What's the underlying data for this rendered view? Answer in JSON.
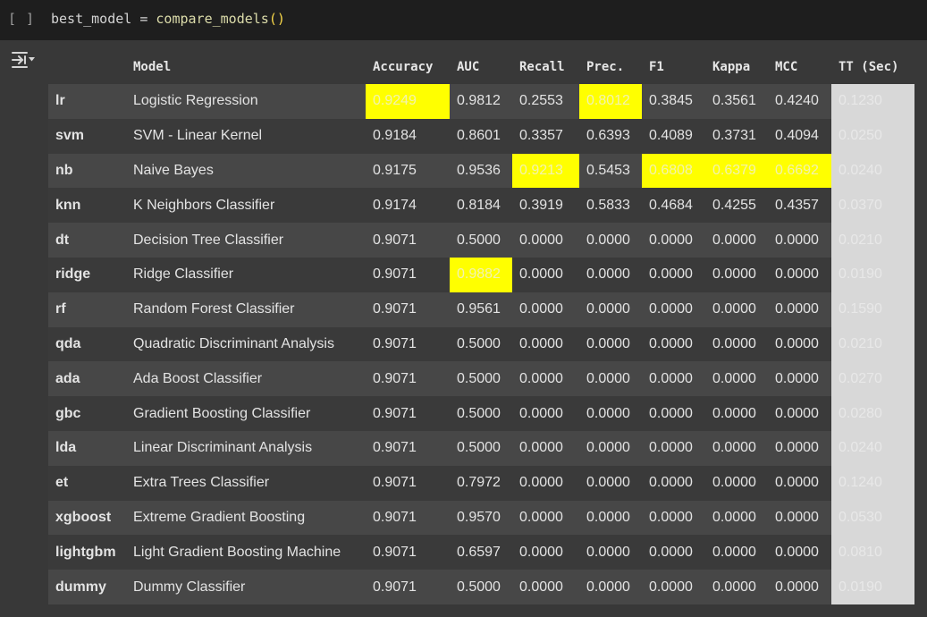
{
  "cell": {
    "run_indicator": "[ ]",
    "code_var": "best_model",
    "code_op": " = ",
    "code_fn": "compare_models",
    "code_parens": "()"
  },
  "table": {
    "headers": [
      "",
      "Model",
      "Accuracy",
      "AUC",
      "Recall",
      "Prec.",
      "F1",
      "Kappa",
      "MCC",
      "TT (Sec)"
    ],
    "rows": [
      {
        "id": "lr",
        "model": "Logistic Regression",
        "accuracy": "0.9249",
        "auc": "0.9812",
        "recall": "0.2553",
        "prec": "0.8012",
        "f1": "0.3845",
        "kappa": "0.3561",
        "mcc": "0.4240",
        "tt": "0.1230"
      },
      {
        "id": "svm",
        "model": "SVM - Linear Kernel",
        "accuracy": "0.9184",
        "auc": "0.8601",
        "recall": "0.3357",
        "prec": "0.6393",
        "f1": "0.4089",
        "kappa": "0.3731",
        "mcc": "0.4094",
        "tt": "0.0250"
      },
      {
        "id": "nb",
        "model": "Naive Bayes",
        "accuracy": "0.9175",
        "auc": "0.9536",
        "recall": "0.9213",
        "prec": "0.5453",
        "f1": "0.6808",
        "kappa": "0.6379",
        "mcc": "0.6692",
        "tt": "0.0240"
      },
      {
        "id": "knn",
        "model": "K Neighbors Classifier",
        "accuracy": "0.9174",
        "auc": "0.8184",
        "recall": "0.3919",
        "prec": "0.5833",
        "f1": "0.4684",
        "kappa": "0.4255",
        "mcc": "0.4357",
        "tt": "0.0370"
      },
      {
        "id": "dt",
        "model": "Decision Tree Classifier",
        "accuracy": "0.9071",
        "auc": "0.5000",
        "recall": "0.0000",
        "prec": "0.0000",
        "f1": "0.0000",
        "kappa": "0.0000",
        "mcc": "0.0000",
        "tt": "0.0210"
      },
      {
        "id": "ridge",
        "model": "Ridge Classifier",
        "accuracy": "0.9071",
        "auc": "0.9882",
        "recall": "0.0000",
        "prec": "0.0000",
        "f1": "0.0000",
        "kappa": "0.0000",
        "mcc": "0.0000",
        "tt": "0.0190"
      },
      {
        "id": "rf",
        "model": "Random Forest Classifier",
        "accuracy": "0.9071",
        "auc": "0.9561",
        "recall": "0.0000",
        "prec": "0.0000",
        "f1": "0.0000",
        "kappa": "0.0000",
        "mcc": "0.0000",
        "tt": "0.1590"
      },
      {
        "id": "qda",
        "model": "Quadratic Discriminant Analysis",
        "accuracy": "0.9071",
        "auc": "0.5000",
        "recall": "0.0000",
        "prec": "0.0000",
        "f1": "0.0000",
        "kappa": "0.0000",
        "mcc": "0.0000",
        "tt": "0.0210"
      },
      {
        "id": "ada",
        "model": "Ada Boost Classifier",
        "accuracy": "0.9071",
        "auc": "0.5000",
        "recall": "0.0000",
        "prec": "0.0000",
        "f1": "0.0000",
        "kappa": "0.0000",
        "mcc": "0.0000",
        "tt": "0.0270"
      },
      {
        "id": "gbc",
        "model": "Gradient Boosting Classifier",
        "accuracy": "0.9071",
        "auc": "0.5000",
        "recall": "0.0000",
        "prec": "0.0000",
        "f1": "0.0000",
        "kappa": "0.0000",
        "mcc": "0.0000",
        "tt": "0.0280"
      },
      {
        "id": "lda",
        "model": "Linear Discriminant Analysis",
        "accuracy": "0.9071",
        "auc": "0.5000",
        "recall": "0.0000",
        "prec": "0.0000",
        "f1": "0.0000",
        "kappa": "0.0000",
        "mcc": "0.0000",
        "tt": "0.0240"
      },
      {
        "id": "et",
        "model": "Extra Trees Classifier",
        "accuracy": "0.9071",
        "auc": "0.7972",
        "recall": "0.0000",
        "prec": "0.0000",
        "f1": "0.0000",
        "kappa": "0.0000",
        "mcc": "0.0000",
        "tt": "0.1240"
      },
      {
        "id": "xgboost",
        "model": "Extreme Gradient Boosting",
        "accuracy": "0.9071",
        "auc": "0.9570",
        "recall": "0.0000",
        "prec": "0.0000",
        "f1": "0.0000",
        "kappa": "0.0000",
        "mcc": "0.0000",
        "tt": "0.0530"
      },
      {
        "id": "lightgbm",
        "model": "Light Gradient Boosting Machine",
        "accuracy": "0.9071",
        "auc": "0.6597",
        "recall": "0.0000",
        "prec": "0.0000",
        "f1": "0.0000",
        "kappa": "0.0000",
        "mcc": "0.0000",
        "tt": "0.0810"
      },
      {
        "id": "dummy",
        "model": "Dummy Classifier",
        "accuracy": "0.9071",
        "auc": "0.5000",
        "recall": "0.0000",
        "prec": "0.0000",
        "f1": "0.0000",
        "kappa": "0.0000",
        "mcc": "0.0000",
        "tt": "0.0190"
      }
    ],
    "highlights": [
      {
        "row": 0,
        "col": "accuracy"
      },
      {
        "row": 0,
        "col": "prec"
      },
      {
        "row": 2,
        "col": "recall"
      },
      {
        "row": 2,
        "col": "f1"
      },
      {
        "row": 2,
        "col": "kappa"
      },
      {
        "row": 2,
        "col": "mcc"
      },
      {
        "row": 5,
        "col": "auc"
      }
    ]
  },
  "colors": {
    "highlight": "#ffff00",
    "tt_column": "#d8d8d8",
    "row_odd": "#474747",
    "row_even": "#3a3a3a",
    "cell_background": "#1e1e1e"
  },
  "icons": {
    "output": "output-toggle-icon"
  }
}
